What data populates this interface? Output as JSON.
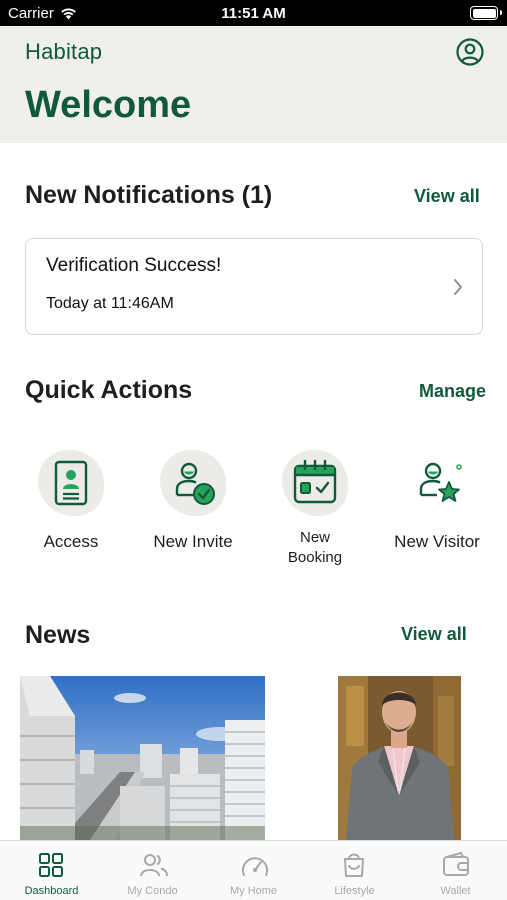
{
  "status_bar": {
    "carrier": "Carrier",
    "time": "11:51 AM"
  },
  "header": {
    "brand": "Habitap",
    "welcome": "Welcome"
  },
  "notifications": {
    "title": "New Notifications (1)",
    "view_all": "View all",
    "items": [
      {
        "title": "Verification Success!",
        "time": "Today at 11:46AM"
      }
    ]
  },
  "quick_actions": {
    "title": "Quick Actions",
    "manage": "Manage",
    "items": [
      {
        "label": "Access",
        "icon": "id-card-icon"
      },
      {
        "label": "New Invite",
        "icon": "user-check-icon"
      },
      {
        "label": "New\nBooking",
        "icon": "calendar-check-icon"
      },
      {
        "label": "New Visitor",
        "icon": "user-star-icon"
      }
    ]
  },
  "news": {
    "title": "News",
    "view_all": "View all"
  },
  "tabs": [
    {
      "label": "Dashboard",
      "icon": "grid-icon",
      "active": true
    },
    {
      "label": "My Condo",
      "icon": "users-icon",
      "active": false
    },
    {
      "label": "My Home",
      "icon": "gauge-icon",
      "active": false
    },
    {
      "label": "Lifestyle",
      "icon": "bag-icon",
      "active": false
    },
    {
      "label": "Wallet",
      "icon": "wallet-icon",
      "active": false
    }
  ],
  "colors": {
    "brand": "#0f5a3a",
    "header_bg": "#f1efeb",
    "muted": "#a8a8a8"
  }
}
